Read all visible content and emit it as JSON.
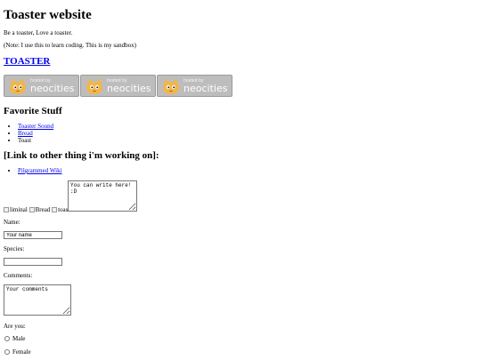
{
  "header": {
    "title": "Toaster website",
    "intro": "Be a toaster, Love a toaster.",
    "note": "(Note: I use this to learn coding. This is my sandbox)"
  },
  "main_link": "TOASTER",
  "badges": {
    "small_text": "hosted by",
    "big_text": "neocities",
    "count": 3
  },
  "favorites": {
    "heading": "Favorite Stuff",
    "items": [
      {
        "label": "Toaster Sound",
        "is_link": true
      },
      {
        "label": "Bread",
        "is_link": true
      },
      {
        "label": "Toast",
        "is_link": false
      }
    ]
  },
  "other": {
    "heading": "[Link to other thing i'm working on]:",
    "items": [
      {
        "label": "Pilgrammed Wiki",
        "is_link": true
      }
    ]
  },
  "images": {
    "alt_texts": [
      "liminal",
      "Bread",
      "toast"
    ]
  },
  "note_box": {
    "value": "You can write here!\n:D"
  },
  "form": {
    "name_label": "Name:",
    "name_value": "Your name",
    "species_label": "Species:",
    "species_value": "",
    "comments_label": "Comments:",
    "comments_value": "Your comments",
    "are_you_label": "Are you:",
    "options": [
      "Male",
      "Female"
    ]
  },
  "colors": {
    "link": "#0000ee",
    "badge_bg": "#bdbdbd"
  }
}
